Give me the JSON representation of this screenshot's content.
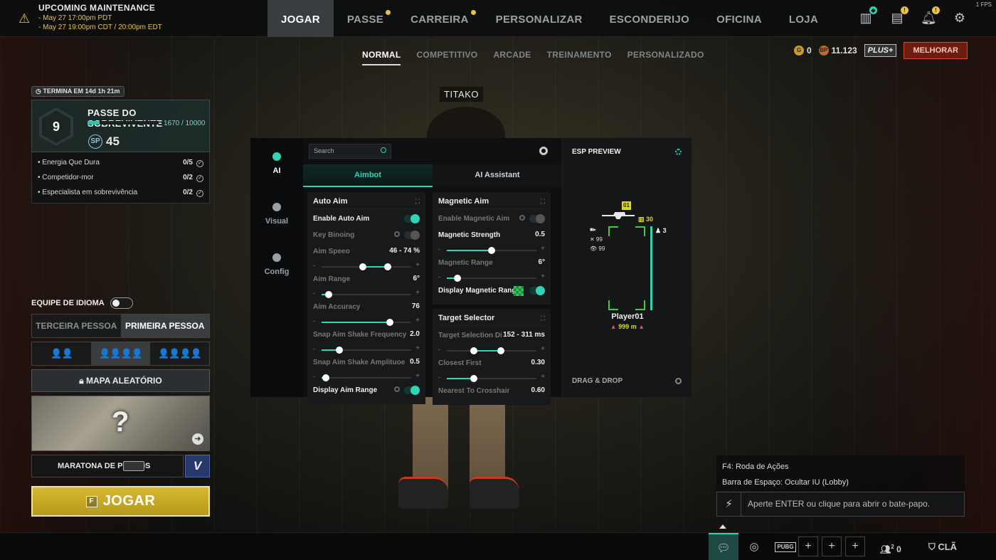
{
  "fps": "1 FPS",
  "maintenance": {
    "title": "UPCOMING MAINTENANCE",
    "line1": "- May 27 17:00pm PDT",
    "line2": "- May 27 19:00pm CDT / 20:00pm EDT"
  },
  "nav": [
    {
      "label": "JOGAR",
      "active": true,
      "dot": false
    },
    {
      "label": "PASSE",
      "active": false,
      "dot": true
    },
    {
      "label": "CARREIRA",
      "active": false,
      "dot": true
    },
    {
      "label": "PERSONALIZAR",
      "active": false,
      "dot": false
    },
    {
      "label": "ESCONDERIJO",
      "active": false,
      "dot": false
    },
    {
      "label": "OFICINA",
      "active": false,
      "dot": false
    },
    {
      "label": "LOJA",
      "active": false,
      "dot": false
    }
  ],
  "subnav": [
    {
      "label": "NORMAL",
      "active": true
    },
    {
      "label": "COMPETITIVO",
      "active": false
    },
    {
      "label": "ARCADE",
      "active": false
    },
    {
      "label": "TREINAMENTO",
      "active": false
    },
    {
      "label": "PERSONALIZADO",
      "active": false
    }
  ],
  "currency": {
    "g_icon": "G",
    "g_coin": "0",
    "bp_icon": "BP",
    "bp": "11.123",
    "plus": "PLUS+",
    "upgrade": "MELHORAR"
  },
  "player_name": "TITAKO",
  "pass": {
    "timer": "TERMINA EM 14d 1h 21m",
    "level": "9",
    "name": "PASSE DO SOBREVIVENTE",
    "xp_current": 1670,
    "xp_max": 10000,
    "xp_text": "1670 / 10000",
    "sp_label": "SP",
    "sp_value": "45",
    "missions": [
      {
        "label": "Energia Que Dura",
        "count": "0/5"
      },
      {
        "label": "Competidor-mor",
        "count": "0/2"
      },
      {
        "label": "Especialista em sobrevivência",
        "count": "0/2"
      }
    ]
  },
  "language_team": "EQUIPE DE IDIOMA",
  "perspective": {
    "third": "TERCEIRA PESSOA",
    "first": "PRIMEIRA PESSOA"
  },
  "squad": {
    "duo": "👤👤",
    "squad": "👤👤👤👤",
    "squad_fpp": "👤👤👤👤"
  },
  "map_random": "MAPA ALEATÓRIO",
  "map_question": "?",
  "marathon": "MARATONA DE PONTOS",
  "play": {
    "key": "F",
    "label": "JOGAR"
  },
  "overlay": {
    "side_tabs": [
      "AI",
      "Visual",
      "Config"
    ],
    "search_placeholder": "Search",
    "tabs": [
      {
        "label": "Aimbot",
        "active": true
      },
      {
        "label": "AI Assistant",
        "active": false
      }
    ],
    "auto_aim": {
      "title": "Auto Aim",
      "enable": {
        "label": "Enable Auto Aim",
        "on": true
      },
      "key_binding": {
        "label": "Key Binoing",
        "on": false
      },
      "aim_speed": {
        "label": "Aim Speeo",
        "value": "46 - 74 %",
        "from": 0.46,
        "to": 0.74
      },
      "aim_range": {
        "label": "Aim Range",
        "value": "6°",
        "fill": 0.08
      },
      "aim_accuracy": {
        "label": "Aim Accuracy",
        "value": "76",
        "fill": 0.76
      },
      "snap_freq": {
        "label": "Snap Aim Shake Frequency",
        "value": "2.0",
        "fill": 0.2
      },
      "snap_amp": {
        "label": "Snap Aim Shake Amplituoe",
        "value": "0.5",
        "fill": 0.05
      },
      "display_range": {
        "label": "Display Aim Range",
        "on": true
      }
    },
    "magnetic_aim": {
      "title": "Magnetic Aim",
      "enable": {
        "label": "Enable Magnetic Aim",
        "on": false
      },
      "strength": {
        "label": "Magnetic Strength",
        "value": "0.5",
        "fill": 0.5
      },
      "range": {
        "label": "Magnetic Range",
        "value": "6°",
        "fill": 0.12
      },
      "display_range": {
        "label": "Display Magnetic Range",
        "on": true
      }
    },
    "target_selector": {
      "title": "Target Selector",
      "distance": {
        "label": "Target Selection Di",
        "value": "152 - 311 ms",
        "from": 0.3,
        "to": 0.6
      },
      "closest": {
        "label": "Closest First",
        "value": "0.30",
        "fill": 0.3
      },
      "crosshair": {
        "label": "Nearest To Crosshair",
        "value": "0.60"
      }
    },
    "esp": {
      "title": "ESP PREVIEW",
      "level": "01",
      "ammo": "30",
      "armor": "3",
      "kills": "✕ 99",
      "seen": "👁 99",
      "player": "Player01",
      "distance": "999 m",
      "drag_drop": "DRAG & DROP"
    }
  },
  "chat": {
    "hint1": "F4: Roda de Ações",
    "hint2": "Barra de Espaço: Ocultar IU (Lobby)",
    "placeholder": "Aperte ENTER ou clique para abrir o bate-papo."
  },
  "bottom": {
    "pubg": "PUBG",
    "friends_badge": "2",
    "friends_count": "0",
    "clan": "CLÃ"
  },
  "colors": {
    "accent": "#30d5b5",
    "gold": "#e7c14a",
    "upgrade": "#d14b33"
  }
}
